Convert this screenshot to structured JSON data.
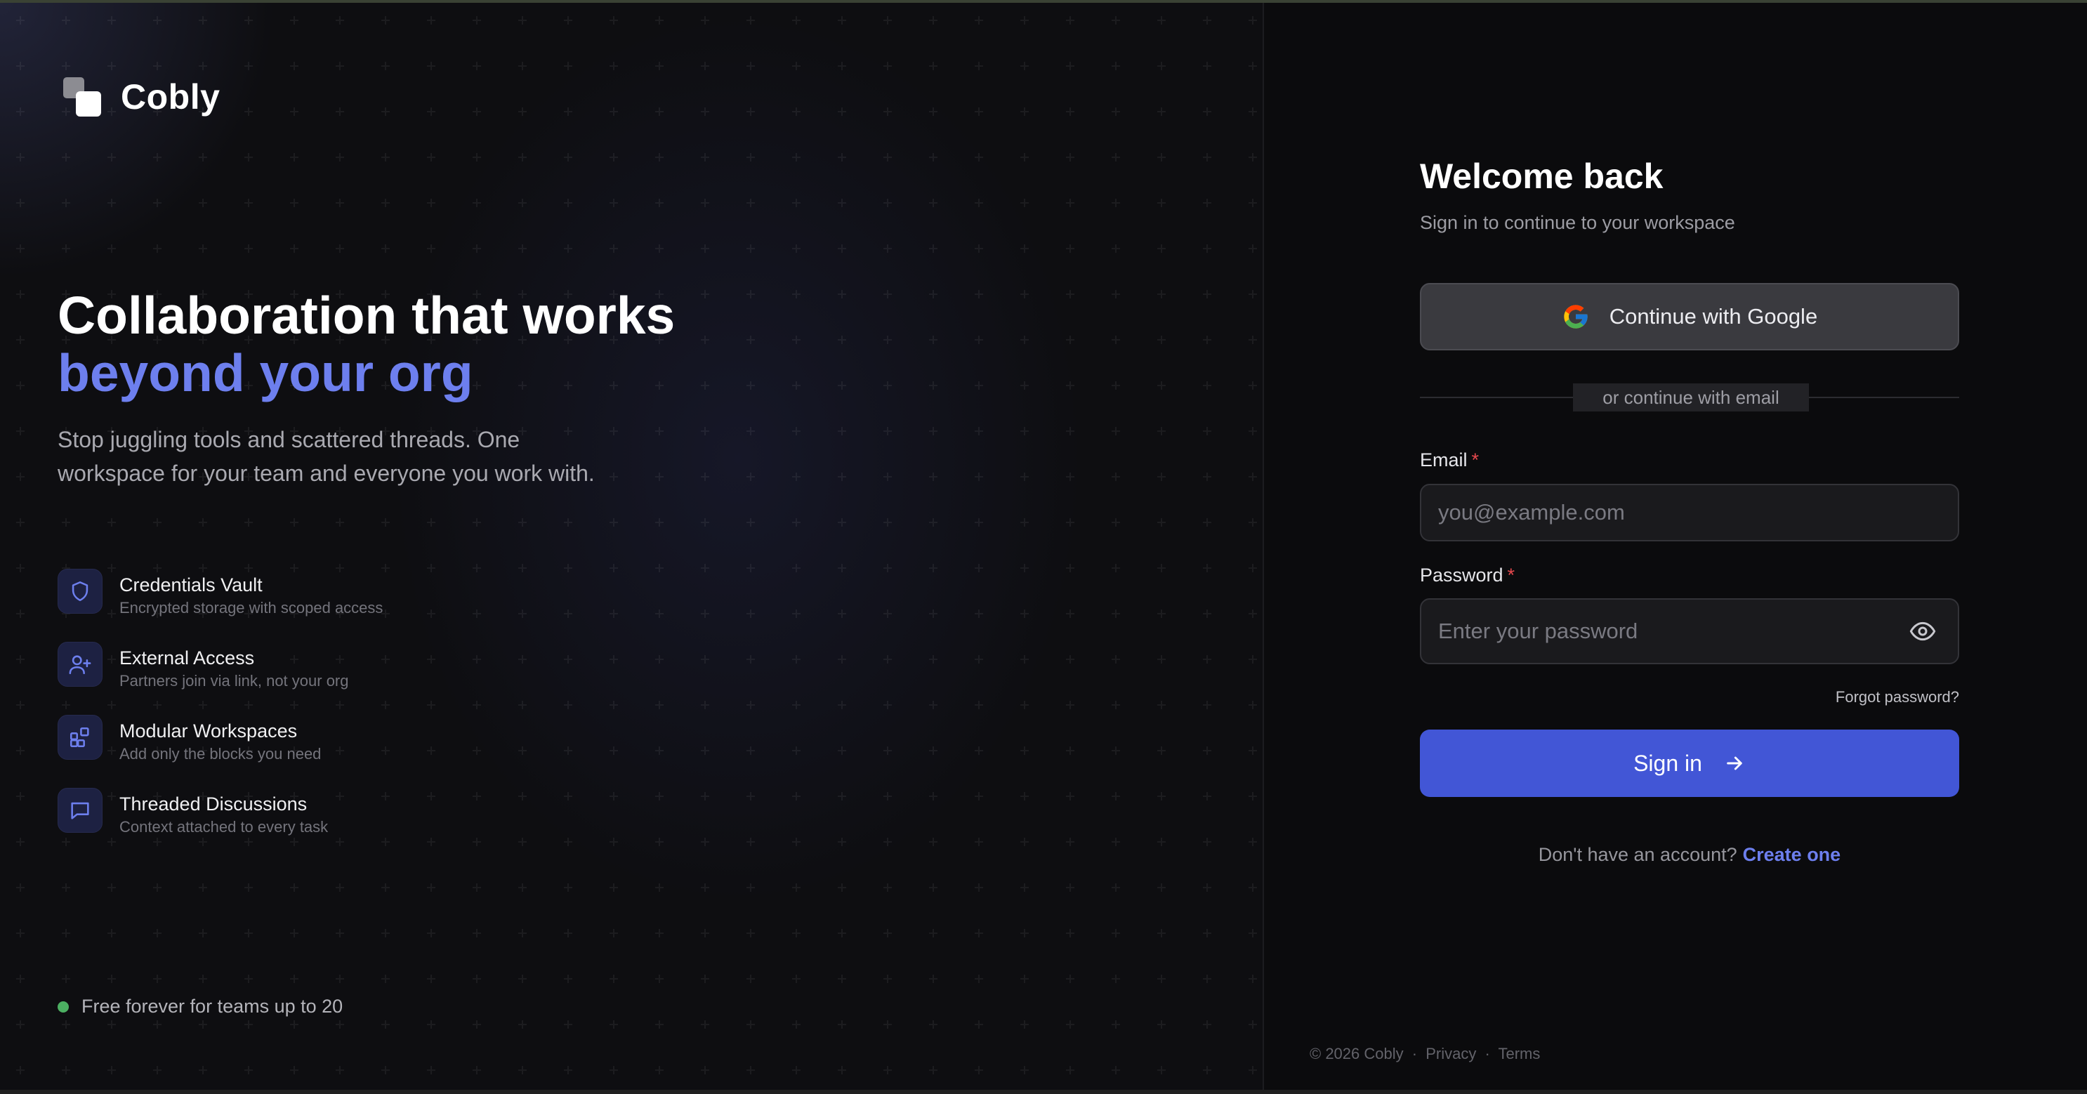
{
  "brand": {
    "name": "Cobly"
  },
  "hero": {
    "title_line1": "Collaboration that works",
    "title_line2": "beyond your org",
    "subtitle": "Stop juggling tools and scattered threads. One workspace for your team and everyone you work with."
  },
  "features": [
    {
      "title": "Credentials Vault",
      "desc": "Encrypted storage with scoped access",
      "icon": "shield-icon"
    },
    {
      "title": "External Access",
      "desc": "Partners join via link, not your org",
      "icon": "user-plus-icon"
    },
    {
      "title": "Modular Workspaces",
      "desc": "Add only the blocks you need",
      "icon": "blocks-icon"
    },
    {
      "title": "Threaded Discussions",
      "desc": "Context attached to every task",
      "icon": "message-square-icon"
    }
  ],
  "free_note": "Free forever for teams up to 20",
  "login": {
    "title": "Welcome back",
    "subtitle": "Sign in to continue to your workspace",
    "google_label": "Continue with Google",
    "divider": "or continue with email",
    "email_label": "Email",
    "email_placeholder": "you@example.com",
    "password_label": "Password",
    "password_placeholder": "Enter your password",
    "required_mark": "*",
    "forgot": "Forgot password?",
    "signin_label": "Sign in",
    "no_account": "Don't have an account?",
    "create": "Create one"
  },
  "footer": {
    "copyright": "© 2026 Cobly",
    "separator": "·",
    "privacy": "Privacy",
    "terms": "Terms"
  },
  "colors": {
    "accent": "#6d7fee",
    "button": "#4256d6",
    "required": "#e5484d",
    "online": "#4caf62"
  }
}
